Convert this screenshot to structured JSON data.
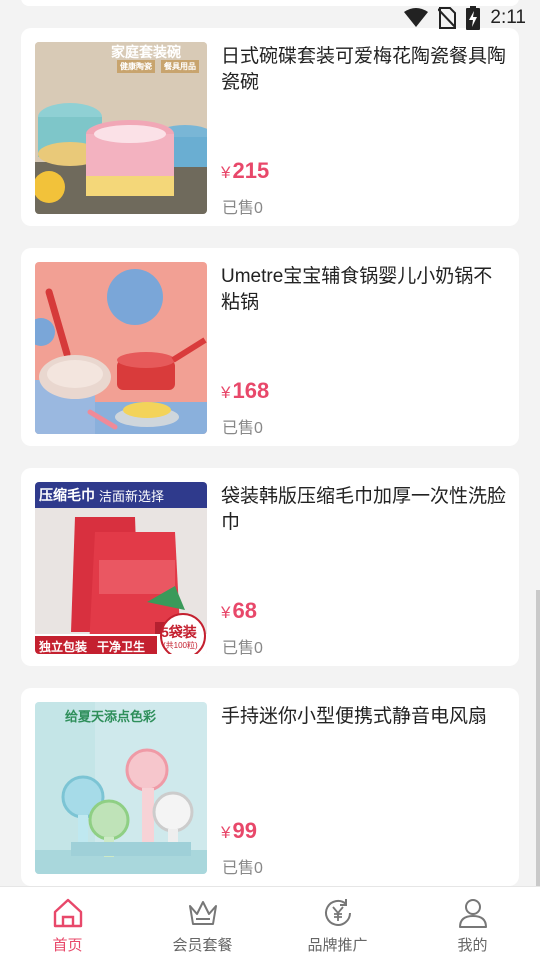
{
  "status_bar": {
    "time": "2:11",
    "icons": [
      "wifi-icon",
      "no-sim-icon",
      "battery-charging-icon"
    ]
  },
  "products": [
    {
      "title": "日式碗碟套装可爱梅花陶瓷餐具陶瓷碗",
      "currency": "¥",
      "price": "215",
      "sold": "已售0",
      "image_text": [
        "家庭套装碗",
        "健康陶瓷",
        "餐具用品"
      ]
    },
    {
      "title": "Umetre宝宝辅食锅婴儿小奶锅不粘锅",
      "currency": "¥",
      "price": "168",
      "sold": "已售0",
      "image_text": []
    },
    {
      "title": "袋装韩版压缩毛巾加厚一次性洗脸巾",
      "currency": "¥",
      "price": "68",
      "sold": "已售0",
      "image_text": [
        "压缩毛巾",
        "洁面新选择",
        "独立包装",
        "干净卫生",
        "5袋装",
        "(共100粒)"
      ]
    },
    {
      "title": "手持迷你小型便携式静音电风扇",
      "currency": "¥",
      "price": "99",
      "sold": "已售0",
      "image_text": [
        "给夏天添点色彩"
      ]
    }
  ],
  "tabbar": {
    "active_color": "#e8486a",
    "items": [
      {
        "label": "首页",
        "icon": "home-icon",
        "active": true
      },
      {
        "label": "会员套餐",
        "icon": "crown-icon",
        "active": false
      },
      {
        "label": "品牌推广",
        "icon": "yen-refresh-icon",
        "active": false
      },
      {
        "label": "我的",
        "icon": "user-icon",
        "active": false
      }
    ]
  }
}
